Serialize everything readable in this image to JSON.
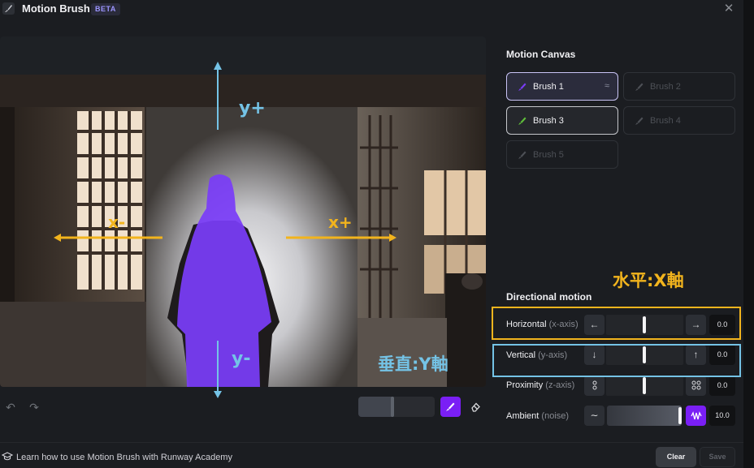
{
  "header": {
    "title": "Motion Brush",
    "badge": "BETA",
    "close_icon": "close-icon"
  },
  "canvas": {
    "axis_labels": {
      "y_plus": "y+",
      "y_minus": "y-",
      "x_minus": "x-",
      "x_plus": "x+"
    },
    "brush_size_fraction": 0.45,
    "tools": {
      "brush": "paint-brush-icon",
      "eraser": "eraser-icon",
      "undo": "undo-icon",
      "redo": "redo-icon"
    }
  },
  "motion_canvas": {
    "title": "Motion Canvas",
    "brushes": [
      {
        "label": "Brush 1",
        "state": "active",
        "color": "#7a3cf7"
      },
      {
        "label": "Brush 2",
        "state": "empty",
        "color": "#4d5056"
      },
      {
        "label": "Brush 3",
        "state": "used",
        "color": "#5fbf3a"
      },
      {
        "label": "Brush 4",
        "state": "empty",
        "color": "#4d5056"
      },
      {
        "label": "Brush 5",
        "state": "empty",
        "color": "#4d5056"
      }
    ]
  },
  "directional_motion": {
    "title": "Directional motion",
    "horizontal": {
      "label": "Horizontal",
      "axis": "(x-axis)",
      "value": "0.0"
    },
    "vertical": {
      "label": "Vertical",
      "axis": "(y-axis)",
      "value": "0.0"
    },
    "proximity": {
      "label": "Proximity",
      "axis": "(z-axis)",
      "value": "0.0"
    },
    "ambient": {
      "label": "Ambient",
      "axis": "(noise)",
      "value": "10.0"
    }
  },
  "annotations": {
    "horizontal": "水平:X軸",
    "vertical": "垂直:Y軸",
    "horizontal_color": "#f2b41d",
    "vertical_color": "#74c3e6"
  },
  "footer": {
    "learn_text": "Learn how to use Motion Brush with Runway Academy",
    "clear_label": "Clear",
    "save_label": "Save"
  }
}
